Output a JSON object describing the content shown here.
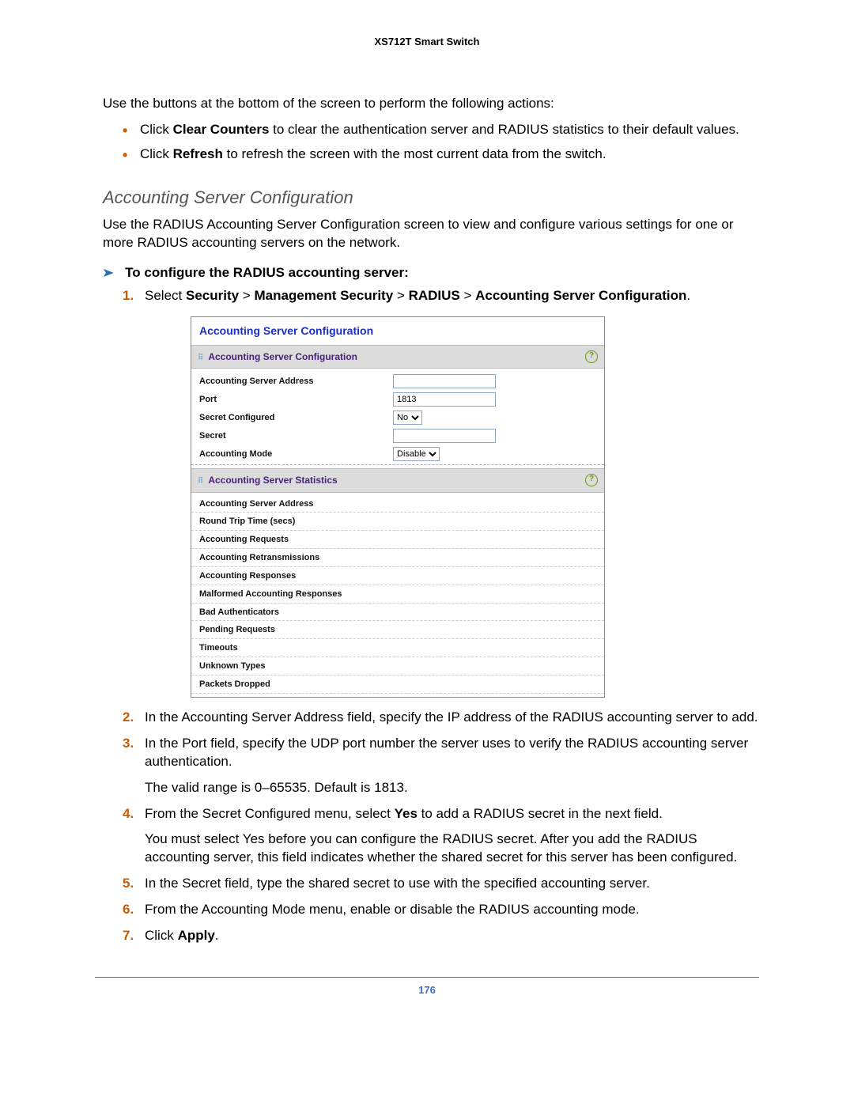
{
  "header": {
    "title": "XS712T Smart Switch"
  },
  "intro": {
    "actions_intro": "Use the buttons at the bottom of the screen to perform the following actions:",
    "bullets": [
      {
        "pre": "Click ",
        "bold": "Clear Counters",
        "post": " to clear the authentication server and RADIUS statistics to their default values."
      },
      {
        "pre": "Click ",
        "bold": "Refresh",
        "post": " to refresh the screen with the most current data from the switch."
      }
    ]
  },
  "section": {
    "heading": "Accounting Server Configuration",
    "para": "Use the RADIUS Accounting Server Configuration screen to view and configure various settings for one or more RADIUS accounting servers on the network.",
    "task_title": "To configure the RADIUS accounting server:"
  },
  "steps": {
    "s1": {
      "pre": "Select ",
      "path": [
        {
          "text": "Security",
          "bold": true
        },
        {
          "text": " > ",
          "bold": false
        },
        {
          "text": "Management Security",
          "bold": true
        },
        {
          "text": " > ",
          "bold": false
        },
        {
          "text": "RADIUS",
          "bold": true
        },
        {
          "text": " > ",
          "bold": false
        },
        {
          "text": "Accounting Server Configuration",
          "bold": true
        },
        {
          "text": ".",
          "bold": false
        }
      ]
    },
    "s2": "In the Accounting Server Address field, specify the IP address of the RADIUS accounting server to add.",
    "s3": {
      "main": "In the Port field, specify the UDP port number the server uses to verify the RADIUS accounting server authentication.",
      "sub": "The valid range is 0–65535. Default is 1813."
    },
    "s4": {
      "pre": "From the Secret Configured menu, select ",
      "bold": "Yes",
      "post": " to add a RADIUS secret in the next field.",
      "sub": "You must select Yes before you can configure the RADIUS secret. After you add the RADIUS accounting server, this field indicates whether the shared secret for this server has been configured."
    },
    "s5": "In the Secret field, type the shared secret to use with the specified accounting server.",
    "s6": "From the Accounting Mode menu, enable or disable the RADIUS accounting mode.",
    "s7": {
      "pre": "Click ",
      "bold": "Apply",
      "post": "."
    }
  },
  "ui": {
    "title": "Accounting Server Configuration",
    "config_bar": "Accounting Server Configuration",
    "stats_bar": "Accounting Server Statistics",
    "help": "?",
    "config_rows": {
      "addr_label": "Accounting Server Address",
      "addr_value": "",
      "port_label": "Port",
      "port_value": "1813",
      "secret_cfg_label": "Secret Configured",
      "secret_cfg_value": "No",
      "secret_label": "Secret",
      "secret_value": "",
      "mode_label": "Accounting Mode",
      "mode_value": "Disable"
    },
    "stats_rows": [
      "Accounting Server Address",
      "Round Trip Time (secs)",
      "Accounting Requests",
      "Accounting Retransmissions",
      "Accounting Responses",
      "Malformed Accounting Responses",
      "Bad Authenticators",
      "Pending Requests",
      "Timeouts",
      "Unknown Types",
      "Packets Dropped"
    ]
  },
  "footer": {
    "page_number": "176"
  }
}
